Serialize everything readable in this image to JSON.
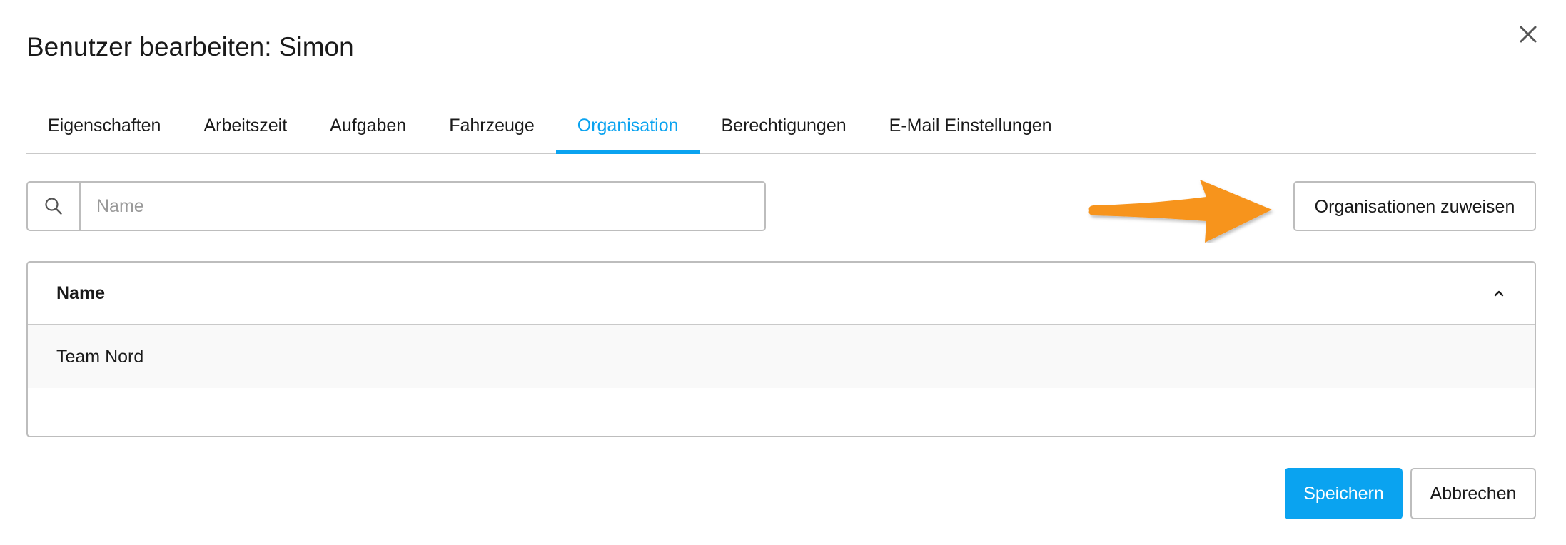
{
  "dialog": {
    "title": "Benutzer bearbeiten: Simon",
    "close_icon": "close-icon"
  },
  "tabs": [
    {
      "label": "Eigenschaften",
      "active": false
    },
    {
      "label": "Arbeitszeit",
      "active": false
    },
    {
      "label": "Aufgaben",
      "active": false
    },
    {
      "label": "Fahrzeuge",
      "active": false
    },
    {
      "label": "Organisation",
      "active": true
    },
    {
      "label": "Berechtigungen",
      "active": false
    },
    {
      "label": "E-Mail Einstellungen",
      "active": false
    }
  ],
  "search": {
    "icon": "search-icon",
    "value": "",
    "placeholder": "Name"
  },
  "assign_button": {
    "label": "Organisationen zuweisen"
  },
  "annotation": {
    "arrow_color": "#f7941d"
  },
  "table": {
    "columns": [
      {
        "label": "Name",
        "sort": "ascending",
        "sort_icon": "chevron-up-icon"
      }
    ],
    "rows": [
      {
        "name": "Team Nord"
      }
    ]
  },
  "footer": {
    "save_label": "Speichern",
    "cancel_label": "Abbrechen"
  },
  "colors": {
    "accent": "#0aa3f0",
    "border": "#bdbdbd",
    "text": "#1a1a1a"
  }
}
